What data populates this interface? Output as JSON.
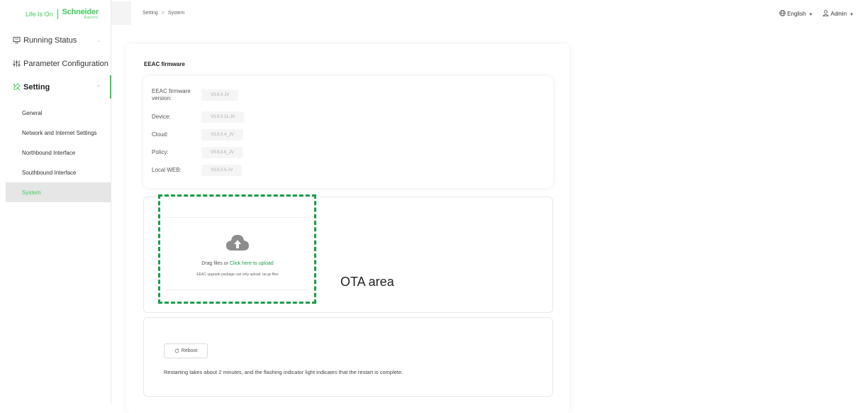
{
  "brand": {
    "tagline": "Life Is On",
    "name": "Schneider",
    "sub": "Electric"
  },
  "breadcrumb": {
    "parent": "Setting",
    "separator": ">",
    "current": "System"
  },
  "header": {
    "language": "English",
    "user": "Admin"
  },
  "sidebar": {
    "items": [
      {
        "label": "Running Status",
        "icon": "monitor-icon"
      },
      {
        "label": "Parameter Configuration",
        "icon": "sliders-icon"
      },
      {
        "label": "Setting",
        "icon": "setting-icon"
      }
    ],
    "sub_items": [
      {
        "label": "General"
      },
      {
        "label": "Network and Internet Settings"
      },
      {
        "label": "Northbound Interface"
      },
      {
        "label": "Southbound Interface"
      },
      {
        "label": "System"
      }
    ]
  },
  "firmware": {
    "title": "EEAC firmware",
    "rows": [
      {
        "label": "EEAC firmware version:",
        "value": "V3.6.0-JV"
      },
      {
        "label": "Device:",
        "value": "V3.6.0.11-JV"
      },
      {
        "label": "Cloud:",
        "value": "V3.6.0.4_JV"
      },
      {
        "label": "Policy:",
        "value": "V3.6.0.6_JV"
      },
      {
        "label": "Local WEB:",
        "value": "V3.6.0.5-JV"
      }
    ]
  },
  "upload": {
    "text": "Drag files or ",
    "link": "Click here to upload",
    "hint": "EEAC upgrade package can only upload. tar.gz files",
    "area_label": "OTA area"
  },
  "reboot": {
    "button": "Reboot",
    "note": "Restarting takes about 2 minutes, and the flashing indicator light indicates that the restart is complete."
  },
  "colors": {
    "accent": "#3dcd58",
    "dashed": "#1a9d4a"
  }
}
